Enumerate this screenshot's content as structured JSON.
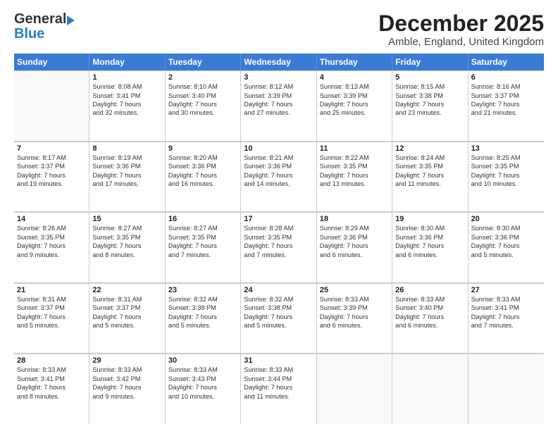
{
  "header": {
    "logo_general": "General",
    "logo_blue": "Blue",
    "month_title": "December 2025",
    "location": "Amble, England, United Kingdom"
  },
  "calendar": {
    "days_of_week": [
      "Sunday",
      "Monday",
      "Tuesday",
      "Wednesday",
      "Thursday",
      "Friday",
      "Saturday"
    ],
    "weeks": [
      [
        {
          "day": "",
          "lines": []
        },
        {
          "day": "1",
          "lines": [
            "Sunrise: 8:08 AM",
            "Sunset: 3:41 PM",
            "Daylight: 7 hours",
            "and 32 minutes."
          ]
        },
        {
          "day": "2",
          "lines": [
            "Sunrise: 8:10 AM",
            "Sunset: 3:40 PM",
            "Daylight: 7 hours",
            "and 30 minutes."
          ]
        },
        {
          "day": "3",
          "lines": [
            "Sunrise: 8:12 AM",
            "Sunset: 3:39 PM",
            "Daylight: 7 hours",
            "and 27 minutes."
          ]
        },
        {
          "day": "4",
          "lines": [
            "Sunrise: 8:13 AM",
            "Sunset: 3:39 PM",
            "Daylight: 7 hours",
            "and 25 minutes."
          ]
        },
        {
          "day": "5",
          "lines": [
            "Sunrise: 8:15 AM",
            "Sunset: 3:38 PM",
            "Daylight: 7 hours",
            "and 23 minutes."
          ]
        },
        {
          "day": "6",
          "lines": [
            "Sunrise: 8:16 AM",
            "Sunset: 3:37 PM",
            "Daylight: 7 hours",
            "and 21 minutes."
          ]
        }
      ],
      [
        {
          "day": "7",
          "lines": [
            "Sunrise: 8:17 AM",
            "Sunset: 3:37 PM",
            "Daylight: 7 hours",
            "and 19 minutes."
          ]
        },
        {
          "day": "8",
          "lines": [
            "Sunrise: 8:19 AM",
            "Sunset: 3:36 PM",
            "Daylight: 7 hours",
            "and 17 minutes."
          ]
        },
        {
          "day": "9",
          "lines": [
            "Sunrise: 8:20 AM",
            "Sunset: 3:36 PM",
            "Daylight: 7 hours",
            "and 16 minutes."
          ]
        },
        {
          "day": "10",
          "lines": [
            "Sunrise: 8:21 AM",
            "Sunset: 3:36 PM",
            "Daylight: 7 hours",
            "and 14 minutes."
          ]
        },
        {
          "day": "11",
          "lines": [
            "Sunrise: 8:22 AM",
            "Sunset: 3:35 PM",
            "Daylight: 7 hours",
            "and 13 minutes."
          ]
        },
        {
          "day": "12",
          "lines": [
            "Sunrise: 8:24 AM",
            "Sunset: 3:35 PM",
            "Daylight: 7 hours",
            "and 11 minutes."
          ]
        },
        {
          "day": "13",
          "lines": [
            "Sunrise: 8:25 AM",
            "Sunset: 3:35 PM",
            "Daylight: 7 hours",
            "and 10 minutes."
          ]
        }
      ],
      [
        {
          "day": "14",
          "lines": [
            "Sunrise: 8:26 AM",
            "Sunset: 3:35 PM",
            "Daylight: 7 hours",
            "and 9 minutes."
          ]
        },
        {
          "day": "15",
          "lines": [
            "Sunrise: 8:27 AM",
            "Sunset: 3:35 PM",
            "Daylight: 7 hours",
            "and 8 minutes."
          ]
        },
        {
          "day": "16",
          "lines": [
            "Sunrise: 8:27 AM",
            "Sunset: 3:35 PM",
            "Daylight: 7 hours",
            "and 7 minutes."
          ]
        },
        {
          "day": "17",
          "lines": [
            "Sunrise: 8:28 AM",
            "Sunset: 3:35 PM",
            "Daylight: 7 hours",
            "and 7 minutes."
          ]
        },
        {
          "day": "18",
          "lines": [
            "Sunrise: 8:29 AM",
            "Sunset: 3:36 PM",
            "Daylight: 7 hours",
            "and 6 minutes."
          ]
        },
        {
          "day": "19",
          "lines": [
            "Sunrise: 8:30 AM",
            "Sunset: 3:36 PM",
            "Daylight: 7 hours",
            "and 6 minutes."
          ]
        },
        {
          "day": "20",
          "lines": [
            "Sunrise: 8:30 AM",
            "Sunset: 3:36 PM",
            "Daylight: 7 hours",
            "and 5 minutes."
          ]
        }
      ],
      [
        {
          "day": "21",
          "lines": [
            "Sunrise: 8:31 AM",
            "Sunset: 3:37 PM",
            "Daylight: 7 hours",
            "and 5 minutes."
          ]
        },
        {
          "day": "22",
          "lines": [
            "Sunrise: 8:31 AM",
            "Sunset: 3:37 PM",
            "Daylight: 7 hours",
            "and 5 minutes."
          ]
        },
        {
          "day": "23",
          "lines": [
            "Sunrise: 8:32 AM",
            "Sunset: 3:38 PM",
            "Daylight: 7 hours",
            "and 5 minutes."
          ]
        },
        {
          "day": "24",
          "lines": [
            "Sunrise: 8:32 AM",
            "Sunset: 3:38 PM",
            "Daylight: 7 hours",
            "and 5 minutes."
          ]
        },
        {
          "day": "25",
          "lines": [
            "Sunrise: 8:33 AM",
            "Sunset: 3:39 PM",
            "Daylight: 7 hours",
            "and 6 minutes."
          ]
        },
        {
          "day": "26",
          "lines": [
            "Sunrise: 8:33 AM",
            "Sunset: 3:40 PM",
            "Daylight: 7 hours",
            "and 6 minutes."
          ]
        },
        {
          "day": "27",
          "lines": [
            "Sunrise: 8:33 AM",
            "Sunset: 3:41 PM",
            "Daylight: 7 hours",
            "and 7 minutes."
          ]
        }
      ],
      [
        {
          "day": "28",
          "lines": [
            "Sunrise: 8:33 AM",
            "Sunset: 3:41 PM",
            "Daylight: 7 hours",
            "and 8 minutes."
          ]
        },
        {
          "day": "29",
          "lines": [
            "Sunrise: 8:33 AM",
            "Sunset: 3:42 PM",
            "Daylight: 7 hours",
            "and 9 minutes."
          ]
        },
        {
          "day": "30",
          "lines": [
            "Sunrise: 8:33 AM",
            "Sunset: 3:43 PM",
            "Daylight: 7 hours",
            "and 10 minutes."
          ]
        },
        {
          "day": "31",
          "lines": [
            "Sunrise: 8:33 AM",
            "Sunset: 3:44 PM",
            "Daylight: 7 hours",
            "and 11 minutes."
          ]
        },
        {
          "day": "",
          "lines": []
        },
        {
          "day": "",
          "lines": []
        },
        {
          "day": "",
          "lines": []
        }
      ]
    ]
  }
}
